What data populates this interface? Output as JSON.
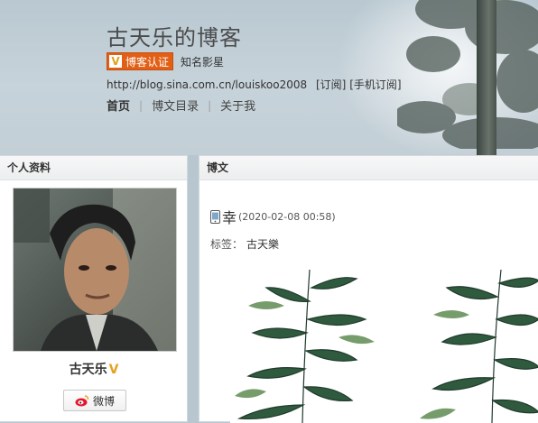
{
  "header": {
    "blog_title": "古天乐的博客",
    "verify_badge": "博客认证",
    "verify_badge_icon": "v-verified-icon",
    "verify_desc": "知名影星",
    "url": "http://blog.sina.com.cn/louiskoo2008",
    "subscribe": "[订阅]",
    "mobile_subscribe": "[手机订阅]",
    "accent_color": "#e25f16"
  },
  "nav": {
    "home": "首页",
    "catalog": "博文目录",
    "about": "关于我"
  },
  "profile": {
    "panel_title": "个人资料",
    "name": "古天乐",
    "verify_mark": "V",
    "weibo_button": "微博"
  },
  "post": {
    "panel_title": "博文",
    "title": "幸",
    "time": "(2020-02-08 00:58)",
    "tags_label": "标签：",
    "tag": "古天樂"
  }
}
